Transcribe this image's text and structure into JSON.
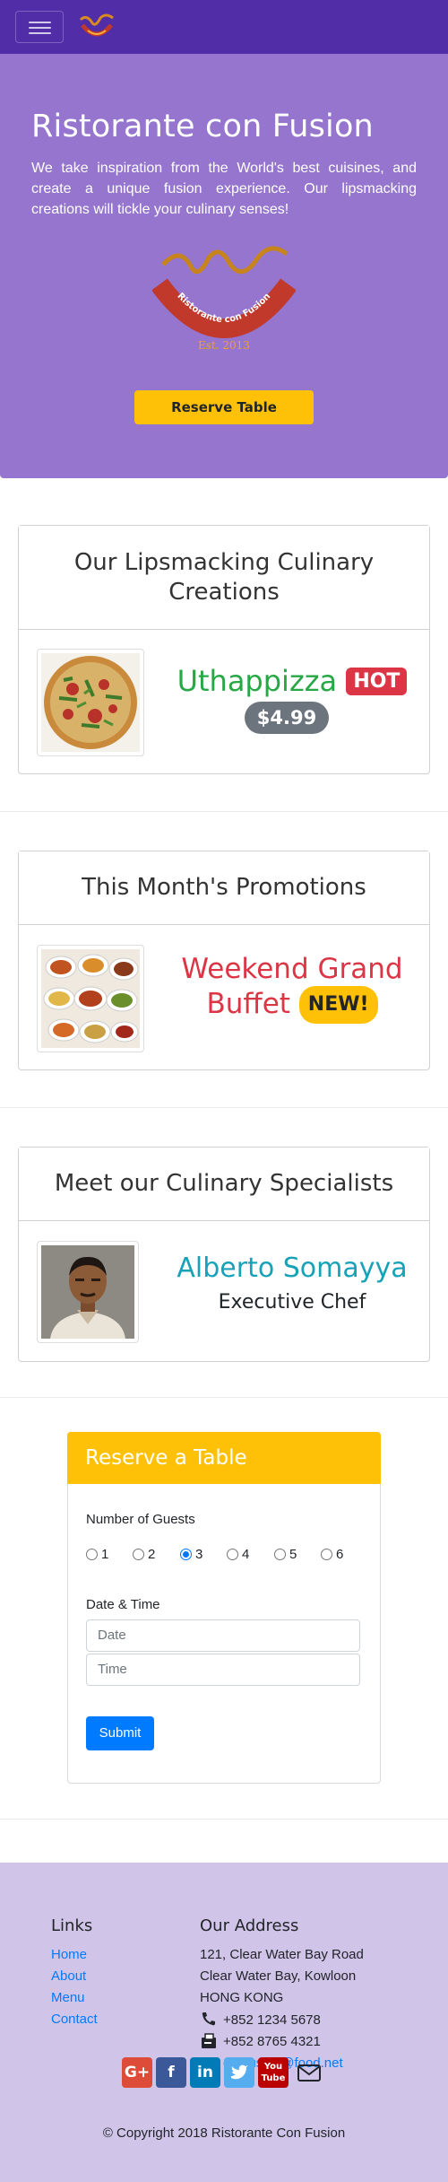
{
  "navbar": {
    "toggle_icon": "hamburger-icon",
    "logo_icon": "restaurant-logo-icon"
  },
  "jumbotron": {
    "title": "Ristorante con Fusion",
    "description": "We take inspiration from the World's best cuisines, and create a unique fusion experience. Our lipsmacking creations will tickle your culinary senses!",
    "logo_text": "Ristorante con Fusion",
    "logo_est": "Est. 2013",
    "reserve_label": "Reserve Table"
  },
  "dish": {
    "header": "Our Lipsmacking Culinary Creations",
    "name": "Uthappizza",
    "badge": "HOT",
    "price": "$4.99"
  },
  "promotion": {
    "header": "This Month's Promotions",
    "name": "Weekend Grand Buffet",
    "badge": "NEW!"
  },
  "leader": {
    "header": "Meet our Culinary Specialists",
    "name": "Alberto Somayya",
    "designation": "Executive Chef"
  },
  "reserve_form": {
    "title": "Reserve a Table",
    "guests_label": "Number of Guests",
    "guest_options": [
      "1",
      "2",
      "3",
      "4",
      "5",
      "6"
    ],
    "selected_guests": "3",
    "datetime_label": "Date & Time",
    "date_placeholder": "Date",
    "time_placeholder": "Time",
    "submit_label": "Submit"
  },
  "footer": {
    "links_heading": "Links",
    "links": [
      "Home",
      "About",
      "Menu",
      "Contact"
    ],
    "address_heading": "Our Address",
    "address_lines": [
      "121, Clear Water Bay Road",
      "Clear Water Bay, Kowloon",
      "HONG KONG"
    ],
    "phone": "+852 1234 5678",
    "fax": "+852 8765 4321",
    "email": "confusion@food.net",
    "social_icons": [
      "google-plus-icon",
      "facebook-icon",
      "linkedin-icon",
      "twitter-icon",
      "youtube-icon",
      "mail-icon"
    ],
    "copyright": "© Copyright 2018 Ristorante Con Fusion"
  },
  "colors": {
    "navbar": "#512da8",
    "jumbotron": "#9575cd",
    "footer": "#d1c4e9",
    "warning": "#ffc107",
    "success": "#28a745",
    "danger": "#dc3545",
    "info": "#17a2b8",
    "primary": "#007bff"
  }
}
